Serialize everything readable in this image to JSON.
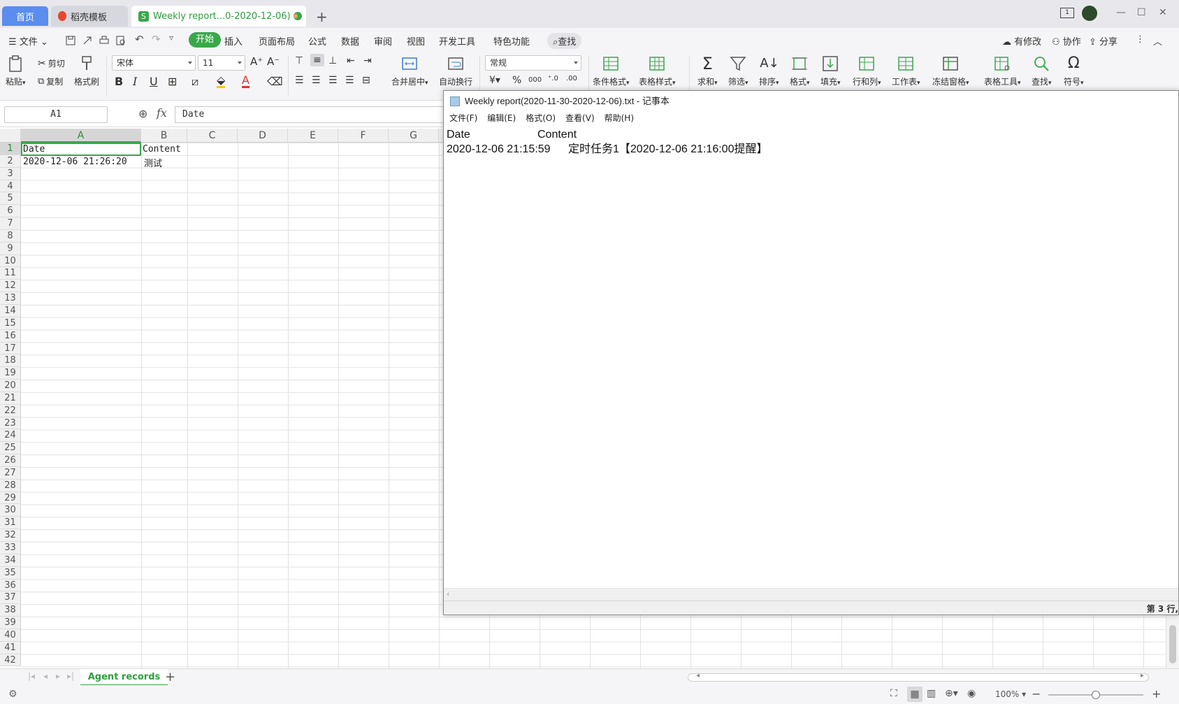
{
  "tabs": {
    "home": "首页",
    "template": "稻壳模板",
    "document": "Weekly report...0-2020-12-06)"
  },
  "menu": {
    "file": "文件",
    "start": "开始",
    "insert": "插入",
    "page_layout": "页面布局",
    "formula": "公式",
    "data": "数据",
    "review": "审阅",
    "view": "视图",
    "dev_tools": "开发工具",
    "special": "特色功能",
    "search": "查找",
    "modified": "有修改",
    "collaborate": "协作",
    "share": "分享"
  },
  "ribbon": {
    "paste": "粘贴",
    "cut": "剪切",
    "copy": "复制",
    "format_painter": "格式刷",
    "font_name": "宋体",
    "font_size": "11",
    "merge_center": "合并居中",
    "wrap_text": "自动换行",
    "number_format": "常规",
    "conditional_format": "条件格式",
    "table_style": "表格样式",
    "sum": "求和",
    "filter": "筛选",
    "sort": "排序",
    "format": "格式",
    "fill": "填充",
    "row_col": "行和列",
    "worksheet": "工作表",
    "freeze": "冻结窗格",
    "table_tools": "表格工具",
    "find": "查找",
    "symbol": "符号"
  },
  "formula_bar": {
    "name_box": "A1",
    "fx": "fx",
    "content": "Date"
  },
  "sheet": {
    "columns": [
      "A",
      "B",
      "C",
      "D",
      "E",
      "F",
      "G"
    ],
    "rows": [
      "1",
      "2",
      "3",
      "4",
      "5",
      "6",
      "7",
      "8",
      "9",
      "10",
      "11",
      "12",
      "13",
      "14",
      "15",
      "16",
      "17",
      "18",
      "19",
      "20",
      "21",
      "22",
      "23",
      "24",
      "25",
      "26",
      "27",
      "28",
      "29",
      "30",
      "31",
      "32",
      "33",
      "34",
      "35",
      "36",
      "37",
      "38",
      "39",
      "40",
      "41",
      "42"
    ],
    "cells": {
      "A1": "Date",
      "B1": "Content",
      "A2": "2020-12-06 21:26:20",
      "B2": "测试"
    },
    "tab_name": "Agent records"
  },
  "statusbar": {
    "zoom": "100%"
  },
  "notepad": {
    "title": "Weekly report(2020-11-30-2020-12-06).txt - 记事本",
    "menu": [
      "文件(F)",
      "编辑(E)",
      "格式(O)",
      "查看(V)",
      "帮助(H)"
    ],
    "header_date": "Date",
    "header_content": "Content",
    "row_date": "2020-12-06 21:15:59",
    "row_content": "定时任务1【2020-12-06 21:16:00提醒】",
    "status": "第 3 行,"
  }
}
